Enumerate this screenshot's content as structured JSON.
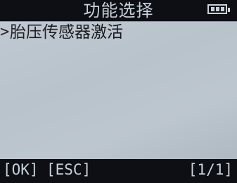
{
  "header": {
    "title": "功能选择",
    "battery_icon": "battery-full-icon"
  },
  "menu": {
    "items": [
      {
        "cursor": ">",
        "label": "胎压传感器激活",
        "selected": true
      }
    ]
  },
  "footer": {
    "ok_label": "[OK]",
    "esc_label": "[ESC]",
    "page_indicator": "[1/1]"
  },
  "colors": {
    "bar_background": "#0e0f14",
    "bar_text": "#c7d2db",
    "screen_background": "#b9c3cc",
    "menu_text": "#0e0f14"
  }
}
